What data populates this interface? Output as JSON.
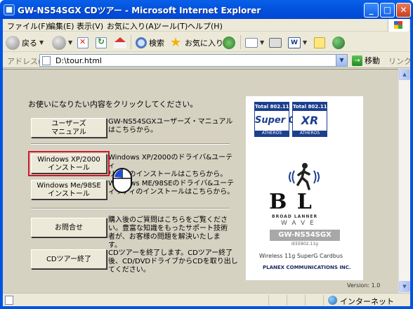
{
  "window": {
    "title": "GW-NS54SGX CDツアー - Microsoft Internet Explorer",
    "min_label": "_",
    "max_label": "□",
    "close_label": "✕"
  },
  "menu": [
    "ファイル(F)",
    "編集(E)",
    "表示(V)",
    "お気に入り(A)",
    "ツール(T)",
    "ヘルプ(H)"
  ],
  "toolbar": {
    "back_label": "戻る",
    "search_label": "検索",
    "favorites_label": "お気に入り",
    "edit_label": "W"
  },
  "address": {
    "label": "アドレス(D)",
    "value": "D:\\tour.html",
    "go_label": "移動",
    "go_arrow": "→",
    "links_label": "リンク »"
  },
  "page": {
    "instruction": "お使いになりたい内容をクリックしてください。",
    "buttons": [
      {
        "label": "ユーザーズ\nマニュアル",
        "desc": "GW-NS54SGXユーザーズ・マニュアル\nはこちらから。"
      },
      {
        "label": "Windows XP/2000\nインストール",
        "desc": "Windows XP/2000のドライバ&ユーティ\nリティのインストールはこちらから。"
      },
      {
        "label": "Windows Me/98SE\nインストール",
        "desc": "Windows ME/98SEのドライバ&ユーテ\nィリティのインストールはこちらから。"
      },
      {
        "label": "お問合せ",
        "desc": "購入後のご質問はこちらをご覧くださ\nい。豊富な知識をもったサポート技術\n者が、お客様の問題を解決いたしま\nす。"
      },
      {
        "label": "CDツアー終了",
        "desc": "CDツアーを終了します。CDツアー終了\n後、CD/DVDドライブからCDを取り出し\nてください。"
      }
    ],
    "selected_button_index": 1,
    "logo": {
      "badge1_top": "Total 802.11",
      "badge1_mid": "Super G",
      "badge1_bot": "ATHEROS",
      "badge2_top": "Total 802.11",
      "badge2_mid": "XR",
      "badge2_bot": "ATHEROS",
      "brand_letters": "B  L",
      "brand_sub": "BROAD LANNER",
      "brand_wave": "WAVE",
      "model": "GW-NS54SGX",
      "model_sub": "IEEE802.11g",
      "wireless": "Wireless 11g SuperG Cardbus",
      "company": "PLANEX COMMUNICATIONS INC."
    },
    "version": "Version: 1.0"
  },
  "status": {
    "zone": "インターネット"
  },
  "colors": {
    "titlebar": "#0054e3",
    "selection_outline": "#d01828",
    "content_bg": "#d6d2c2",
    "logo_blue": "#1c3f8f"
  },
  "icons": [
    "back-icon",
    "forward-icon",
    "stop-icon",
    "refresh-icon",
    "home-icon",
    "search-icon",
    "favorites-star-icon",
    "history-icon",
    "mail-icon",
    "print-icon",
    "edit-icon",
    "note-icon",
    "messenger-icon",
    "go-arrow-icon",
    "page-icon",
    "globe-icon",
    "mouse-cursor-icon"
  ]
}
